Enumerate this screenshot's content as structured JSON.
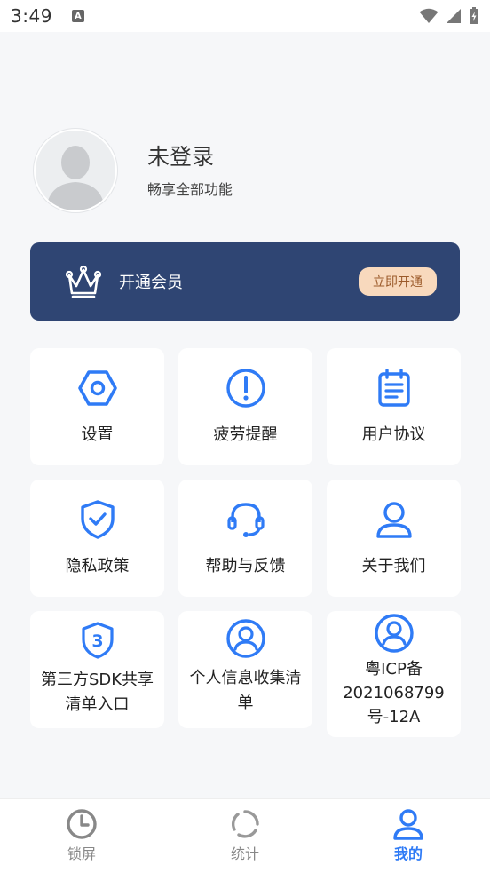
{
  "status_bar": {
    "time": "3:49",
    "notif_letter": "A"
  },
  "profile": {
    "name": "未登录",
    "subtitle": "畅享全部功能"
  },
  "vip": {
    "title": "开通会员",
    "button_label": "立即开通"
  },
  "colors": {
    "accent": "#2f7bf6",
    "banner": "#2f4573",
    "vip_button": "#f8d9bd"
  },
  "menu": [
    {
      "label": "设置",
      "icon": "settings-hexagon-icon"
    },
    {
      "label": "疲劳提醒",
      "icon": "alert-circle-icon"
    },
    {
      "label": "用户协议",
      "icon": "document-icon"
    },
    {
      "label": "隐私政策",
      "icon": "shield-check-icon"
    },
    {
      "label": "帮助与反馈",
      "icon": "headset-icon"
    },
    {
      "label": "关于我们",
      "icon": "user-icon"
    },
    {
      "label": "第三方SDK共享清单入口",
      "icon": "shield-number-icon"
    },
    {
      "label": "个人信息收集清单",
      "icon": "user-circle-icon"
    },
    {
      "label": "粤ICP备2021068799号-12A",
      "icon": "user-circle-icon"
    }
  ],
  "tabs": [
    {
      "label": "锁屏",
      "icon": "clock-icon"
    },
    {
      "label": "统计",
      "icon": "stats-ring-icon"
    },
    {
      "label": "我的",
      "icon": "profile-icon"
    }
  ]
}
